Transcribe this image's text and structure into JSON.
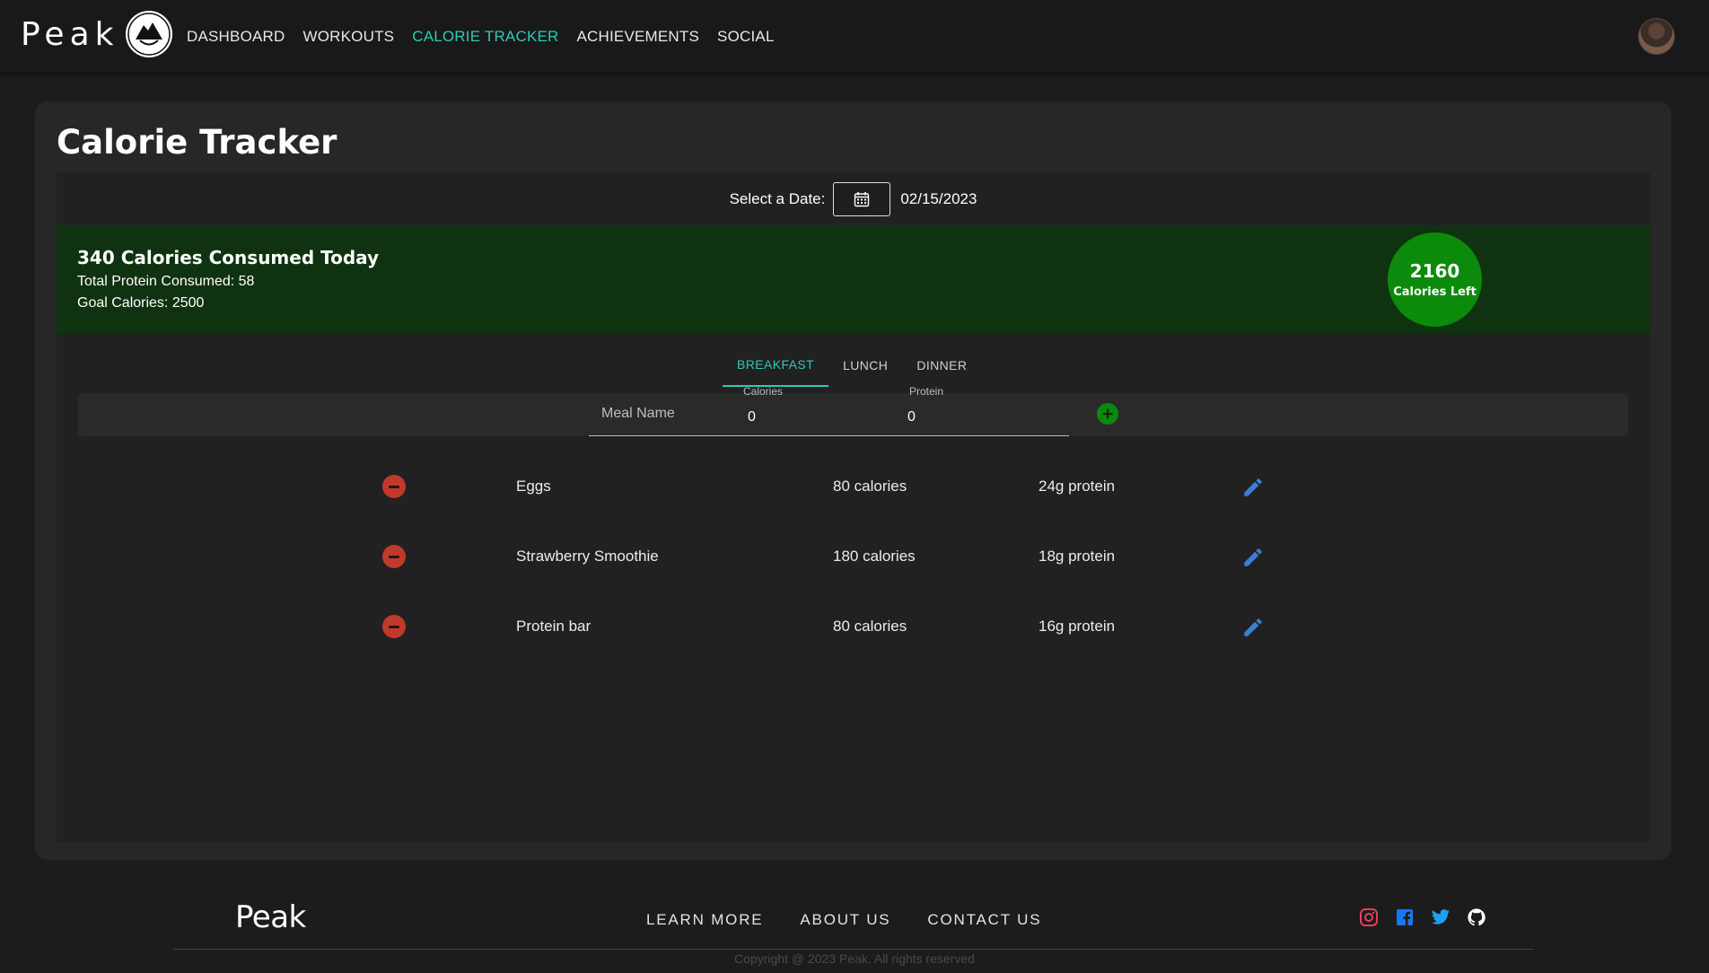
{
  "nav": {
    "brand": "Peak",
    "links": [
      {
        "label": "DASHBOARD",
        "active": false
      },
      {
        "label": "WORKOUTS",
        "active": false
      },
      {
        "label": "CALORIE TRACKER",
        "active": true
      },
      {
        "label": "ACHIEVEMENTS",
        "active": false
      },
      {
        "label": "SOCIAL",
        "active": false
      }
    ],
    "active_color": "#2fc9b7"
  },
  "page": {
    "title": "Calorie Tracker"
  },
  "date": {
    "label": "Select a Date:",
    "value": "02/15/2023",
    "icon": "calendar-icon"
  },
  "summary": {
    "title": "340 Calories Consumed Today",
    "protein_line": "Total Protein Consumed: 58",
    "goal_line": "Goal Calories: 2500",
    "calories_left": "2160",
    "calories_left_label": "Calories Left",
    "banner_color": "#0f3310",
    "circle_color": "#0b8a0b"
  },
  "tabs": [
    {
      "label": "BREAKFAST",
      "active": true
    },
    {
      "label": "LUNCH",
      "active": false
    },
    {
      "label": "DINNER",
      "active": false
    }
  ],
  "add_form": {
    "meal_name_placeholder": "Meal Name",
    "calories_label": "Calories",
    "calories_value": "0",
    "protein_label": "Protein",
    "protein_value": "0",
    "add_icon": "plus-icon"
  },
  "meals": [
    {
      "name": "Eggs",
      "calories": "80 calories",
      "protein": "24g protein"
    },
    {
      "name": "Strawberry Smoothie",
      "calories": "180 calories",
      "protein": "18g protein"
    },
    {
      "name": "Protein bar",
      "calories": "80 calories",
      "protein": "16g protein"
    }
  ],
  "footer": {
    "brand": "Peak",
    "links": [
      "LEARN MORE",
      "ABOUT US",
      "CONTACT US"
    ],
    "socials": [
      "instagram-icon",
      "facebook-icon",
      "twitter-icon",
      "github-icon"
    ],
    "copyright": "Copyright @ 2023 Peak. All rights reserved"
  }
}
